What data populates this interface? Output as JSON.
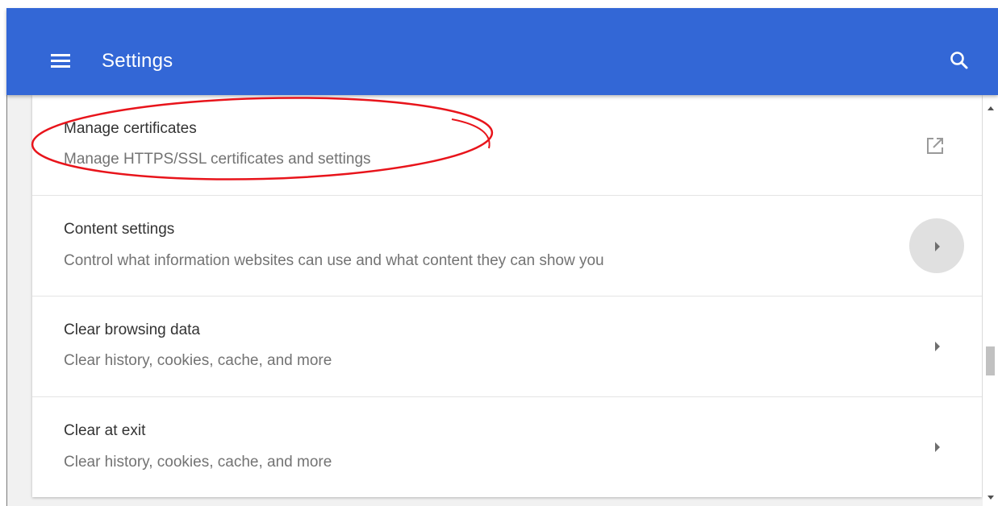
{
  "header": {
    "title": "Settings",
    "background": "#3367d6",
    "menu_icon": "hamburger-menu-icon",
    "search_icon": "search-icon"
  },
  "rows": [
    {
      "title": "Manage certificates",
      "subtitle": "Manage HTTPS/SSL certificates and settings",
      "action_icon": "open-in-new-icon"
    },
    {
      "title": "Content settings",
      "subtitle": "Control what information websites can use and what content they can show you",
      "action_icon": "chevron-right-icon",
      "state": "hovered"
    },
    {
      "title": "Clear browsing data",
      "subtitle": "Clear history, cookies, cache, and more",
      "action_icon": "chevron-right-icon"
    },
    {
      "title": "Clear at exit",
      "subtitle": "Clear history, cookies, cache, and more",
      "action_icon": "chevron-right-icon"
    }
  ],
  "annotation": {
    "shape": "ellipse",
    "color": "#e8141b",
    "target": "Manage certificates"
  },
  "colors": {
    "title_text": "#333333",
    "subtitle_text": "#737373",
    "page_background": "#f1f1f1"
  }
}
